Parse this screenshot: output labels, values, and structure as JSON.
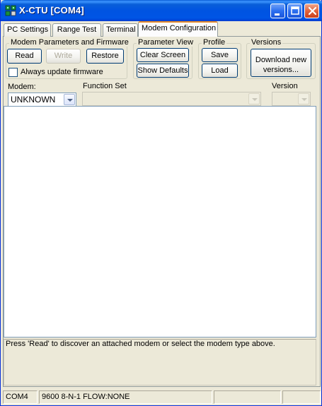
{
  "window": {
    "title": "X-CTU  [COM4]"
  },
  "tabs": [
    {
      "label": "PC Settings"
    },
    {
      "label": "Range Test"
    },
    {
      "label": "Terminal"
    },
    {
      "label": "Modem Configuration",
      "active": true
    }
  ],
  "groups": {
    "modem_params": {
      "label": "Modem Parameters and Firmware",
      "read": "Read",
      "write": "Write",
      "restore": "Restore",
      "always_update": "Always update firmware",
      "always_update_checked": false
    },
    "parameter_view": {
      "label": "Parameter View",
      "clear_screen": "Clear Screen",
      "show_defaults": "Show Defaults"
    },
    "profile": {
      "label": "Profile",
      "save": "Save",
      "load": "Load"
    },
    "versions": {
      "label": "Versions",
      "download_line1": "Download new",
      "download_line2": "versions..."
    }
  },
  "selectors": {
    "modem_label": "Modem:",
    "modem_value": "UNKNOWN",
    "function_set_label": "Function Set",
    "function_set_value": "",
    "version_label": "Version",
    "version_value": ""
  },
  "message": "Press 'Read' to discover an attached modem or select the modem type above.",
  "statusbar": {
    "port": "COM4",
    "settings": "9600 8-N-1  FLOW:NONE"
  },
  "colors": {
    "titlebar": "#0055e5",
    "window_bg": "#ece9d8",
    "active_tab_accent": "#e68b2c",
    "close_button": "#e2643c"
  }
}
